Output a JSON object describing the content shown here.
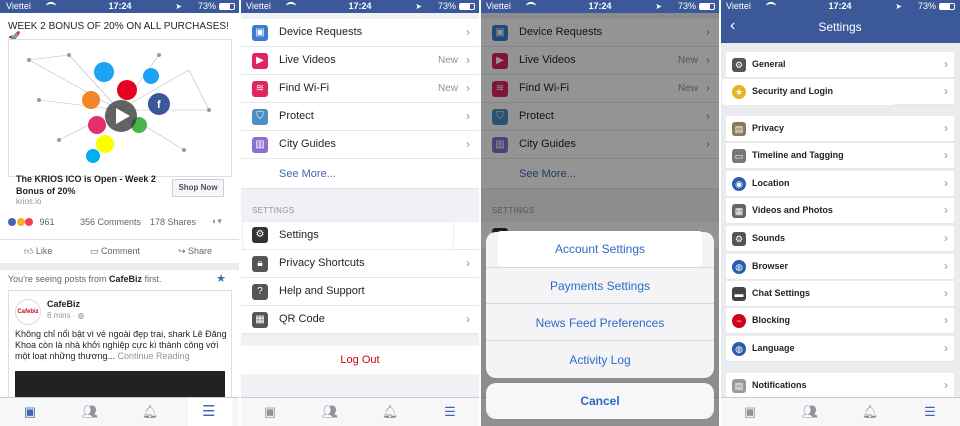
{
  "status": {
    "carrier": "Viettel",
    "time": "17:24",
    "battery": "73%"
  },
  "panel1": {
    "ad_header": "WEEK 2 BONUS OF 20% ON ALL PURCHASES! 🚀",
    "ad_title": "The KRIOS ICO is Open - Week 2 Bonus of 20%",
    "ad_domain": "krios.io",
    "shop_now": "Shop Now",
    "reaction_count": "961",
    "comments": "356 Comments",
    "shares": "178 Shares",
    "like": "Like",
    "comment": "Comment",
    "share": "Share",
    "seeing_prefix": "You're seeing posts from ",
    "seeing_page": "CafeBiz",
    "seeing_suffix": " first.",
    "post_author": "CafeBiz",
    "post_time": "8 mins · ",
    "post_text": "Không chỉ nổi bật vì vẻ ngoài đẹp trai, shark Lê Đăng Khoa còn là nhà khởi nghiệp cực kì thành công với một loạt những thương... ",
    "continue_reading": "Continue Reading",
    "logo_text": "Cafebiz"
  },
  "panel2": {
    "items": [
      {
        "label": "Device Requests",
        "new": ""
      },
      {
        "label": "Live Videos",
        "new": "New"
      },
      {
        "label": "Find Wi-Fi",
        "new": "New"
      },
      {
        "label": "Protect",
        "new": ""
      },
      {
        "label": "City Guides",
        "new": ""
      }
    ],
    "see_more": "See More...",
    "settings_section": "SETTINGS",
    "settings_items": [
      {
        "label": "Settings"
      },
      {
        "label": "Privacy Shortcuts"
      },
      {
        "label": "Help and Support"
      },
      {
        "label": "QR Code"
      }
    ],
    "logout": "Log Out"
  },
  "panel3": {
    "sheet_options": [
      "Account Settings",
      "Payments Settings",
      "News Feed Preferences",
      "Activity Log"
    ],
    "cancel": "Cancel"
  },
  "panel4": {
    "title": "Settings",
    "items": [
      {
        "label": "General",
        "icon": "gear-icon"
      },
      {
        "label": "Security and Login",
        "icon": "shield-icon"
      },
      {
        "label": "Privacy",
        "icon": "lock-icon"
      },
      {
        "label": "Timeline and Tagging",
        "icon": "timeline-icon"
      },
      {
        "label": "Location",
        "icon": "location-icon"
      },
      {
        "label": "Videos and Photos",
        "icon": "film-icon"
      },
      {
        "label": "Sounds",
        "icon": "gear-icon"
      },
      {
        "label": "Browser",
        "icon": "globe-icon"
      },
      {
        "label": "Chat Settings",
        "icon": "chat-icon"
      },
      {
        "label": "Blocking",
        "icon": "block-icon"
      },
      {
        "label": "Language",
        "icon": "globe-icon"
      },
      {
        "label": "Notifications",
        "icon": "bell-icon"
      }
    ]
  },
  "colors": {
    "fb_blue": "#3b5998",
    "link_blue": "#4267b2",
    "ios_blue": "#2b6bc6",
    "logout_red": "#d0021b"
  }
}
